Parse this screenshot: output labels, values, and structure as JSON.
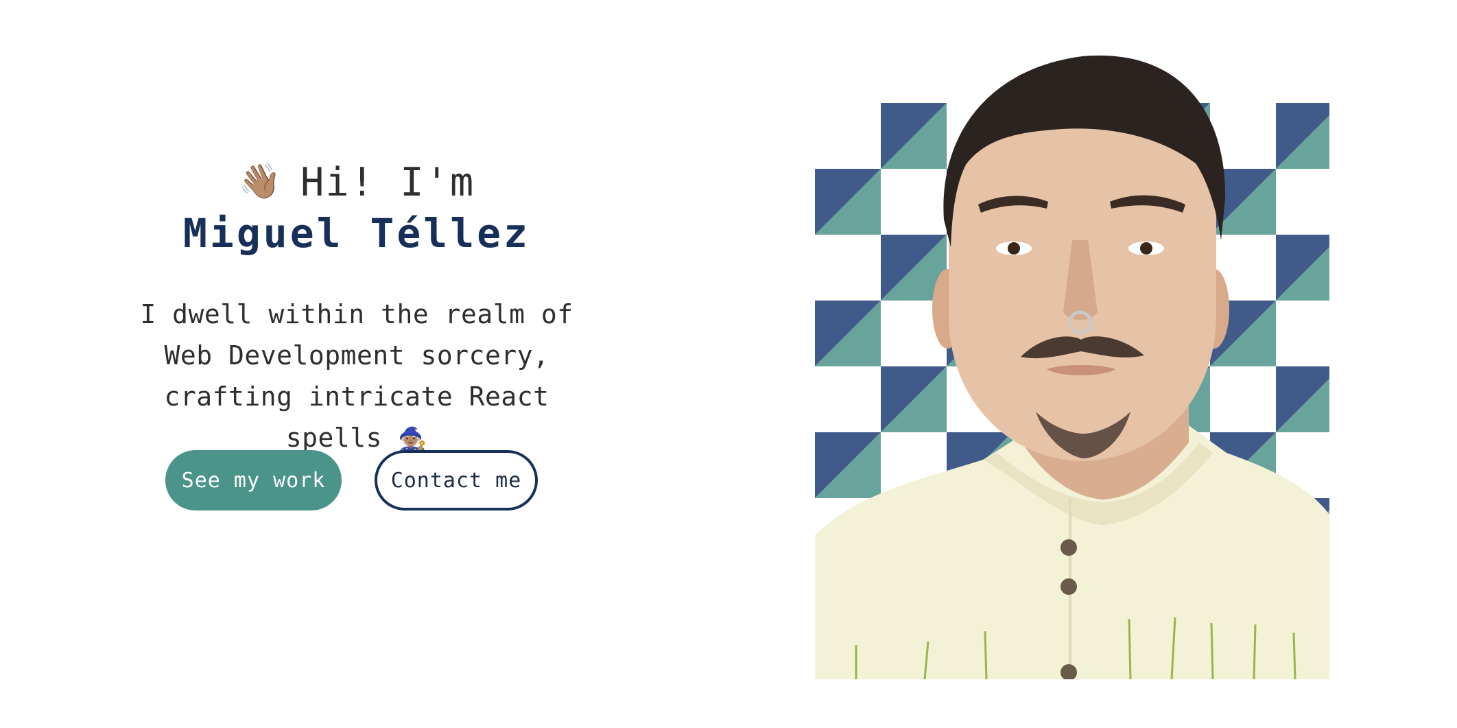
{
  "hero": {
    "wave_icon": "waving-hand-icon",
    "wave_glyph": "👋🏽",
    "greeting": "Hi! I'm",
    "name": "Miguel Téllez",
    "tagline": "I dwell within the realm of Web Development sorcery, crafting intricate React spells",
    "mage_icon": "mage-icon",
    "mage_glyph": "🧙🏽"
  },
  "actions": {
    "primary_label": "See my work",
    "secondary_label": "Contact me"
  },
  "portrait": {
    "alt": "Portrait of Miguel Téllez",
    "pattern_colors": {
      "navy": "#405b8a",
      "teal": "#68a49b",
      "white": "#ffffff"
    },
    "shirt_color": "#f3f1d6",
    "hair_color": "#2a2320",
    "skin_color": "#e6c2a6"
  },
  "colors": {
    "accent": "#4a9489",
    "brand_navy": "#16305a",
    "text": "#2e2e2e"
  }
}
